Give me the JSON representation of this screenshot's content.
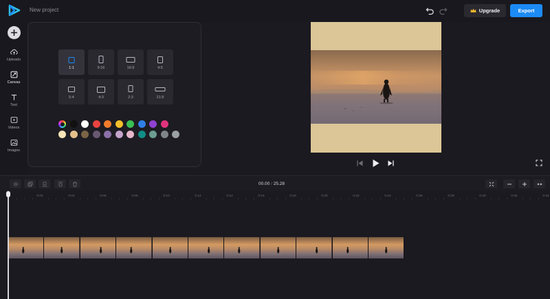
{
  "header": {
    "project_name": "New project",
    "upgrade_label": "Upgrade",
    "export_label": "Export"
  },
  "sidebar": {
    "items": [
      {
        "label": "Uploads",
        "icon": "upload-cloud-icon"
      },
      {
        "label": "Canvas",
        "icon": "canvas-resize-icon",
        "active": true
      },
      {
        "label": "Text",
        "icon": "text-t-icon"
      },
      {
        "label": "Videos",
        "icon": "video-play-icon"
      },
      {
        "label": "Images",
        "icon": "image-icon"
      }
    ]
  },
  "canvas_panel": {
    "ratios": [
      {
        "label": "1:1",
        "selected": true
      },
      {
        "label": "9:16"
      },
      {
        "label": "16:9"
      },
      {
        "label": "4:5"
      },
      {
        "label": "5:4"
      },
      {
        "label": "4:3"
      },
      {
        "label": "2:3"
      },
      {
        "label": "21:9"
      }
    ],
    "colors_row1": [
      "picker",
      "#111111",
      "#ffffff",
      "#e8433f",
      "#f17c2c",
      "#f5c02b",
      "#3bbf53",
      "#2f7fe6",
      "#8f42d0",
      "#e0337d"
    ],
    "colors_row2": [
      "#f7e4b8",
      "#e5c08b",
      "#7b6445",
      "#6a5872",
      "#8b6fa8",
      "#c5a3cb",
      "#e6b6c9",
      "#0f8d86",
      "#6d9e92",
      "#7f8588",
      "#9aa0a4"
    ]
  },
  "preview": {
    "background_color": "#dcc697"
  },
  "timeline": {
    "current_time": "00.00",
    "separator": "/",
    "total_time": "25.28",
    "ruler_labels": [
      "0",
      "0:02",
      "0:04",
      "0:06",
      "0:08",
      "0:10",
      "0:12",
      "0:14",
      "0:16",
      "0:18",
      "0:20",
      "0:22",
      "0:24",
      "0:26",
      "0:28",
      "0:30",
      "0:32",
      "0:34"
    ]
  },
  "colors": {
    "accent": "#1c8bf5",
    "background": "#1b1a20"
  }
}
